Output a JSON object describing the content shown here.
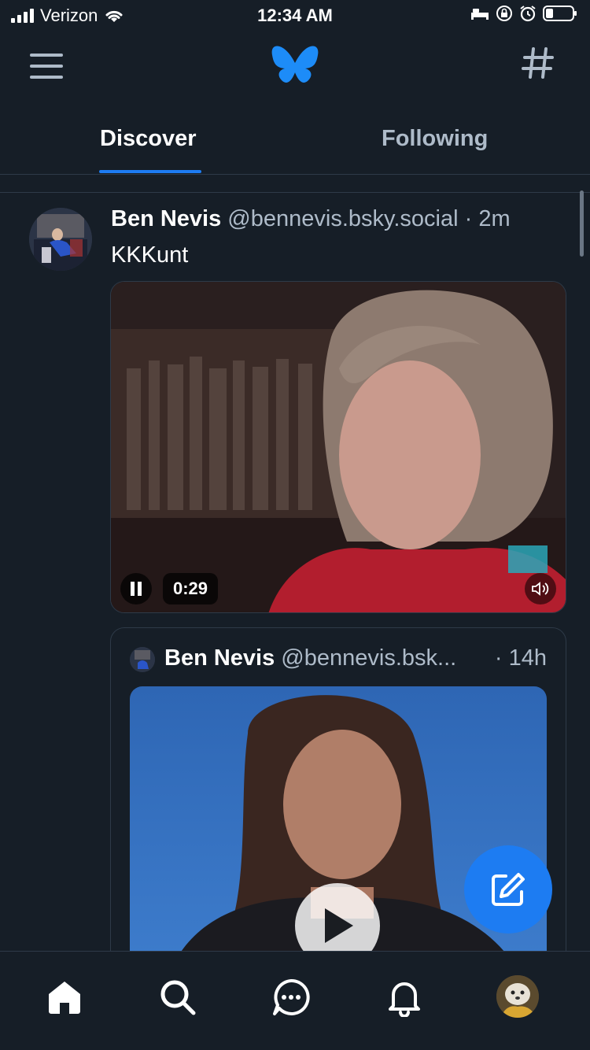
{
  "status": {
    "carrier": "Verizon",
    "time": "12:34 AM"
  },
  "tabs": {
    "discover": "Discover",
    "following": "Following"
  },
  "post": {
    "author_name": "Ben Nevis",
    "author_handle": "@bennevis.bsky.social",
    "time": "· 2m",
    "text": "KKKunt",
    "video_time": "0:29"
  },
  "quote": {
    "author_name": "Ben Nevis",
    "author_handle": "@bennevis.bsk...",
    "time": "· 14h"
  },
  "colors": {
    "accent": "#1d7cf2",
    "background": "#161e27",
    "muted": "#aebbc9"
  },
  "icons": [
    "menu-icon",
    "butterfly-logo",
    "hash-icon",
    "pause-icon",
    "volume-icon",
    "play-icon",
    "compose-icon",
    "home-icon",
    "search-icon",
    "chat-icon",
    "bell-icon"
  ]
}
